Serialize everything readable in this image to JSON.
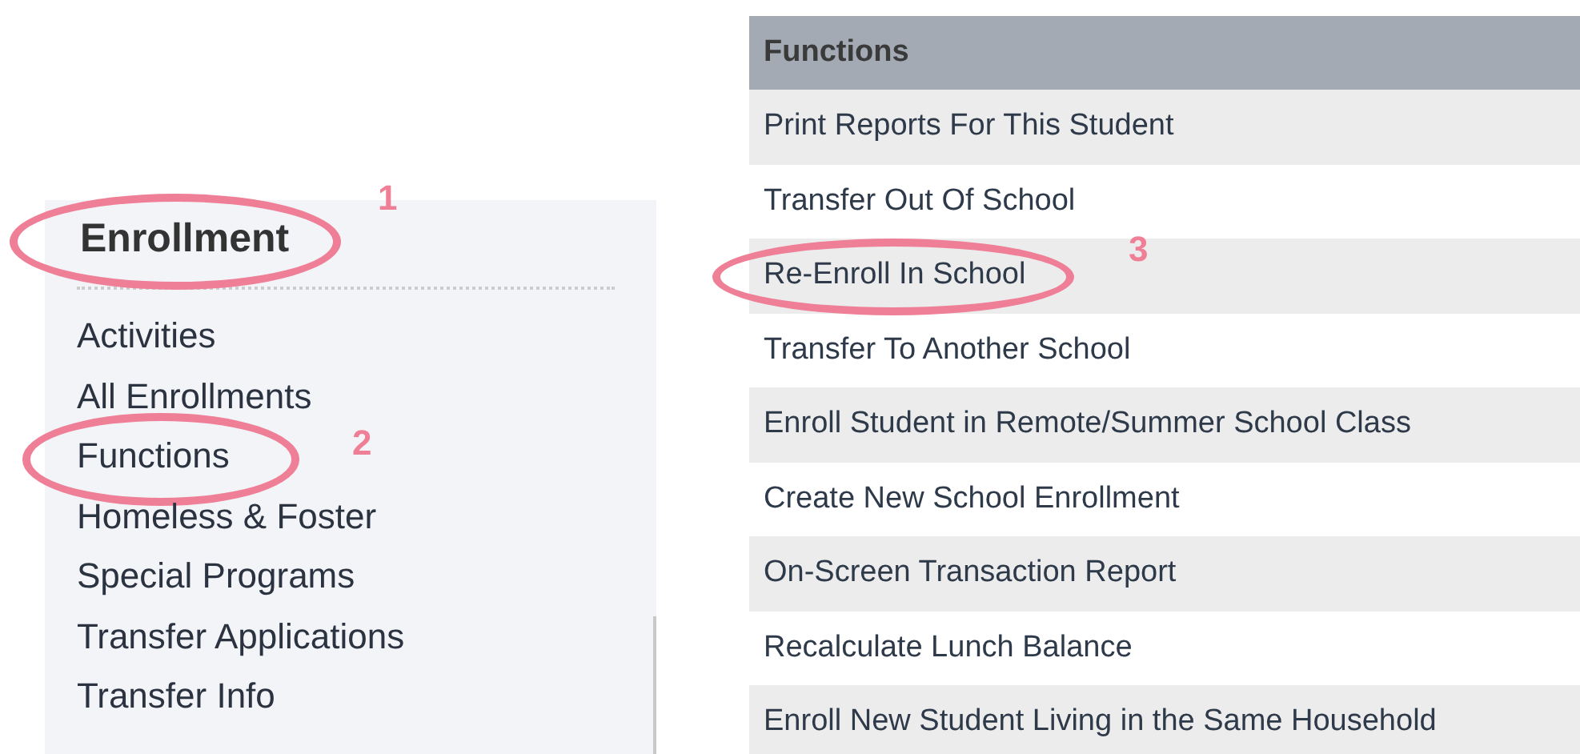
{
  "sidebar": {
    "title": "Enrollment",
    "title_callout": "1",
    "items": [
      {
        "label": "Activities"
      },
      {
        "label": "All Enrollments"
      },
      {
        "label": "Functions",
        "callout": "2"
      },
      {
        "label": "Homeless & Foster"
      },
      {
        "label": "Special Programs"
      },
      {
        "label": "Transfer Applications"
      },
      {
        "label": "Transfer Info"
      }
    ]
  },
  "functions": {
    "header": "Functions",
    "rows": [
      {
        "label": "Print Reports For This Student"
      },
      {
        "label": "Transfer Out Of School"
      },
      {
        "label": "Re-Enroll In School",
        "callout": "3"
      },
      {
        "label": "Transfer To Another School"
      },
      {
        "label": "Enroll Student in Remote/Summer School Class"
      },
      {
        "label": "Create New School Enrollment"
      },
      {
        "label": "On-Screen Transaction Report"
      },
      {
        "label": "Recalculate Lunch Balance"
      },
      {
        "label": "Enroll New Student Living in the Same Household"
      }
    ]
  }
}
